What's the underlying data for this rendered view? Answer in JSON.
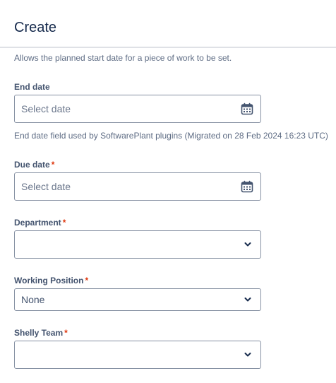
{
  "header": {
    "title": "Create"
  },
  "start_date": {
    "description": "Allows the planned start date for a piece of work to be set."
  },
  "end_date": {
    "label": "End date",
    "placeholder": "Select date",
    "icon": "calendar-icon",
    "description": "End date field used by SoftwarePlant plugins (Migrated on 28 Feb 2024 16:23 UTC)"
  },
  "due_date": {
    "label": "Due date",
    "required_marker": "*",
    "placeholder": "Select date",
    "icon": "calendar-icon"
  },
  "department": {
    "label": "Department",
    "required_marker": "*",
    "value": "",
    "icon": "chevron-down-icon"
  },
  "working_position": {
    "label": "Working Position",
    "required_marker": "*",
    "value": "None",
    "icon": "chevron-down-icon"
  },
  "shelly_team": {
    "label": "Shelly Team",
    "required_marker": "*",
    "value": "",
    "icon": "chevron-down-icon"
  },
  "colors": {
    "text": "#172b4d",
    "subtle_text": "#5e6c84",
    "field_border": "#8590a2",
    "required": "#de350b"
  }
}
